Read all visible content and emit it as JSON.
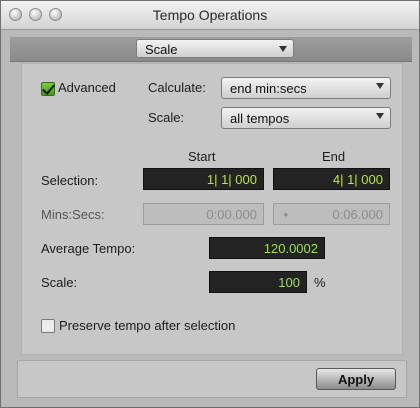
{
  "window": {
    "title": "Tempo Operations"
  },
  "operation": {
    "selected": "Scale"
  },
  "options": {
    "advanced_label": "Advanced",
    "advanced_checked": true,
    "calculate_label": "Calculate:",
    "calculate_value": "end min:secs",
    "scale_label": "Scale:",
    "scale_value": "all tempos"
  },
  "columns": {
    "start": "Start",
    "end": "End"
  },
  "rows": {
    "selection_label": "Selection:",
    "selection_start": "1| 1| 000",
    "selection_end": "4| 1| 000",
    "minsecs_label": "Mins:Secs:",
    "minsecs_start": "0:00.000",
    "minsecs_end": "0:06.000",
    "avg_tempo_label": "Average Tempo:",
    "avg_tempo_value": "120.0002",
    "scale_label": "Scale:",
    "scale_value": "100",
    "scale_unit": "%"
  },
  "preserve": {
    "label": "Preserve tempo after selection",
    "checked": false
  },
  "footer": {
    "apply_label": "Apply"
  },
  "colors": {
    "field_bg": "#232323",
    "field_text": "#b8e83a",
    "check_on": "#5bb826"
  }
}
